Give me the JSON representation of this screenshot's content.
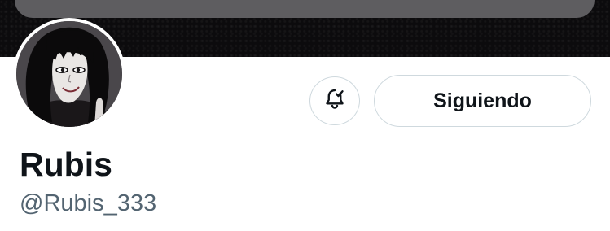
{
  "profile": {
    "display_name": "Rubis",
    "handle": "@Rubis_333"
  },
  "actions": {
    "follow_label": "Siguiendo",
    "notifications_icon": "bell-check-icon"
  },
  "colors": {
    "text_primary": "#0f1419",
    "text_secondary": "#536471",
    "button_border": "#cfd9de",
    "banner": "#0c0b0d",
    "overlay": "#5e5d60"
  }
}
